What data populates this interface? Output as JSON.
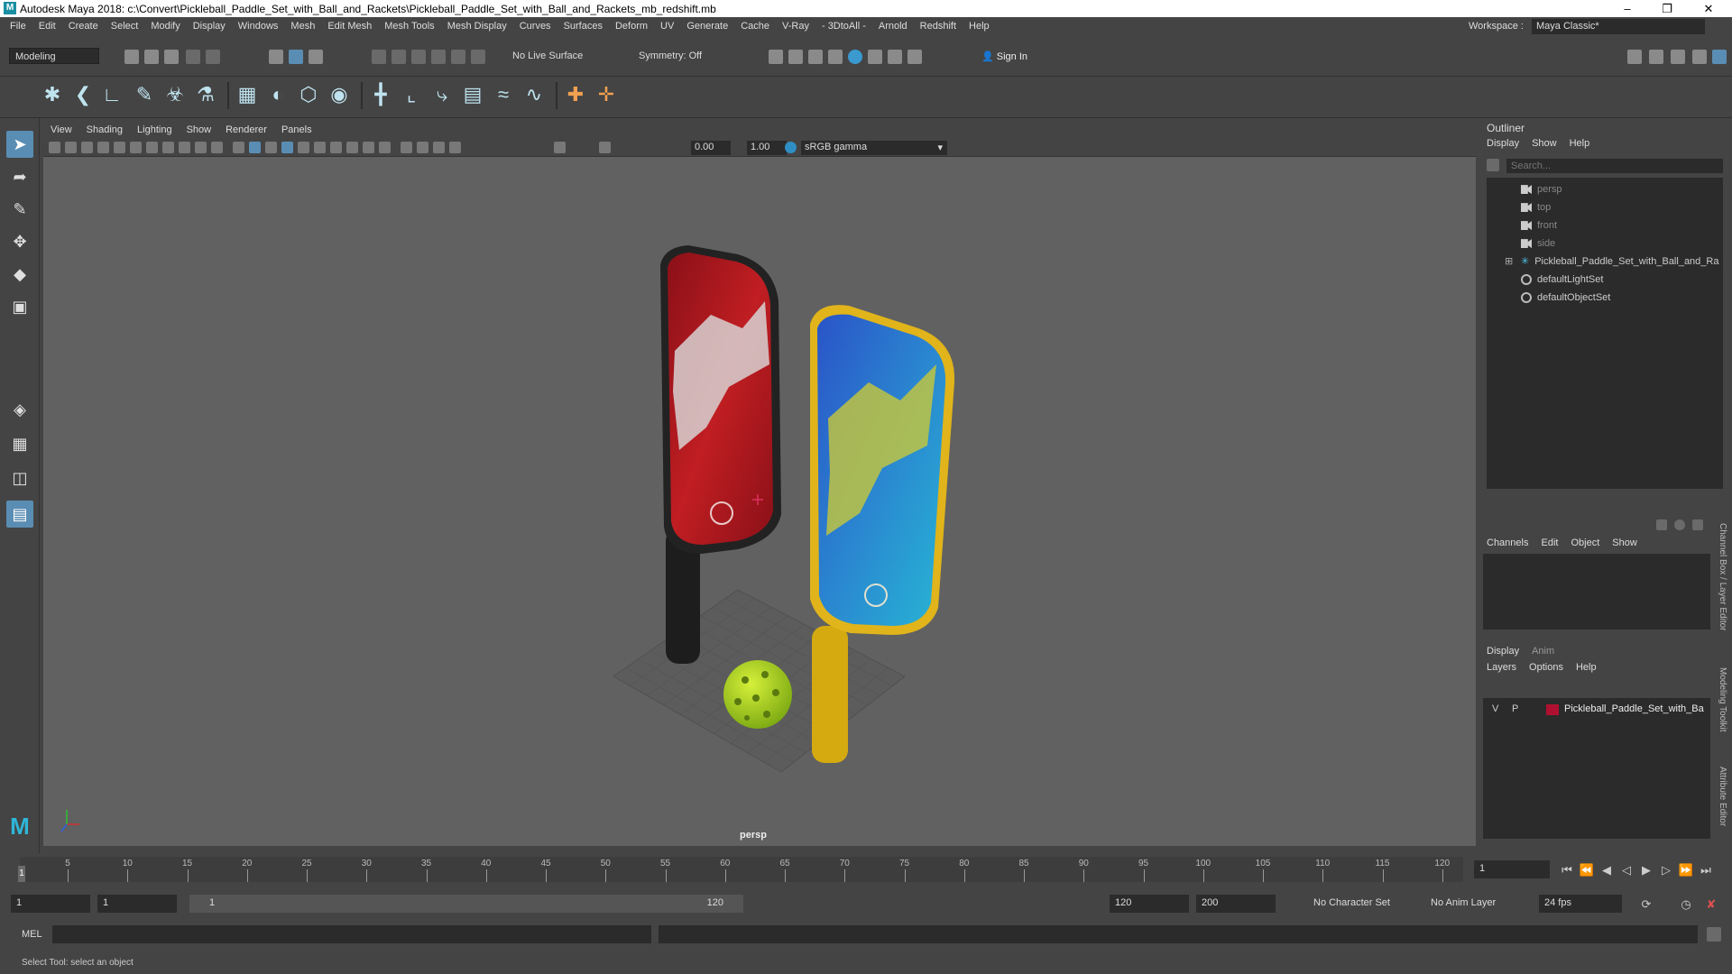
{
  "app": {
    "title": "Autodesk Maya 2018: c:\\Convert\\Pickleball_Paddle_Set_with_Ball_and_Rackets\\Pickleball_Paddle_Set_with_Ball_and_Rackets_mb_redshift.mb",
    "logo": "M"
  },
  "menubar": {
    "items": [
      "File",
      "Edit",
      "Create",
      "Select",
      "Modify",
      "Display",
      "Windows",
      "Mesh",
      "Edit Mesh",
      "Mesh Tools",
      "Mesh Display",
      "Curves",
      "Surfaces",
      "Deform",
      "UV",
      "Generate",
      "Cache",
      "V-Ray",
      "- 3DtoAll -",
      "Arnold",
      "Redshift",
      "Help"
    ],
    "workspace_label": "Workspace :",
    "workspace_value": "Maya Classic*"
  },
  "statusline": {
    "mode": "Modeling",
    "live_surface": "No Live Surface",
    "symmetry": "Symmetry: Off",
    "sign_in": "Sign In"
  },
  "panel": {
    "menus": [
      "View",
      "Shading",
      "Lighting",
      "Show",
      "Renderer",
      "Panels"
    ],
    "exposure": "0.00",
    "gamma": "1.00",
    "color_space": "sRGB gamma",
    "camera": "persp"
  },
  "outliner": {
    "title": "Outliner",
    "menus": [
      "Display",
      "Show",
      "Help"
    ],
    "search_placeholder": "Search...",
    "items": [
      {
        "label": "persp",
        "type": "camera"
      },
      {
        "label": "top",
        "type": "camera"
      },
      {
        "label": "front",
        "type": "camera"
      },
      {
        "label": "side",
        "type": "camera"
      },
      {
        "label": "Pickleball_Paddle_Set_with_Ball_and_Ra",
        "type": "group"
      },
      {
        "label": "defaultLightSet",
        "type": "set"
      },
      {
        "label": "defaultObjectSet",
        "type": "set"
      }
    ]
  },
  "channelbox": {
    "menus": [
      "Channels",
      "Edit",
      "Object",
      "Show"
    ]
  },
  "layers": {
    "tabs": [
      "Display",
      "Anim"
    ],
    "menus": [
      "Layers",
      "Options",
      "Help"
    ],
    "row": {
      "v": "V",
      "p": "P",
      "name": "Pickleball_Paddle_Set_with_Ba",
      "color": "#b01030"
    }
  },
  "sidetabs": [
    "Channel Box / Layer Editor",
    "Modeling Toolkit",
    "Attribute Editor"
  ],
  "timeline": {
    "ticks": [
      5,
      10,
      15,
      20,
      25,
      30,
      35,
      40,
      45,
      50,
      55,
      60,
      65,
      70,
      75,
      80,
      85,
      90,
      95,
      100,
      105,
      110,
      115,
      120
    ],
    "current_frame": "1",
    "start_marker": "1"
  },
  "range": {
    "start": "1",
    "start2": "1",
    "slider_start": "1",
    "slider_end": "120",
    "end": "120",
    "end2": "200",
    "character_set": "No Character Set",
    "anim_layer": "No Anim Layer",
    "fps": "24 fps"
  },
  "cmdline": {
    "label": "MEL"
  },
  "helpline": {
    "text": "Select Tool: select an object"
  },
  "colors": {
    "active_tool": "#5a8db3",
    "paddle_red": "#9a1420",
    "paddle_blue": "#2a64c8",
    "paddle_yellow": "#e0b41a",
    "ball": "#a8d41c"
  }
}
